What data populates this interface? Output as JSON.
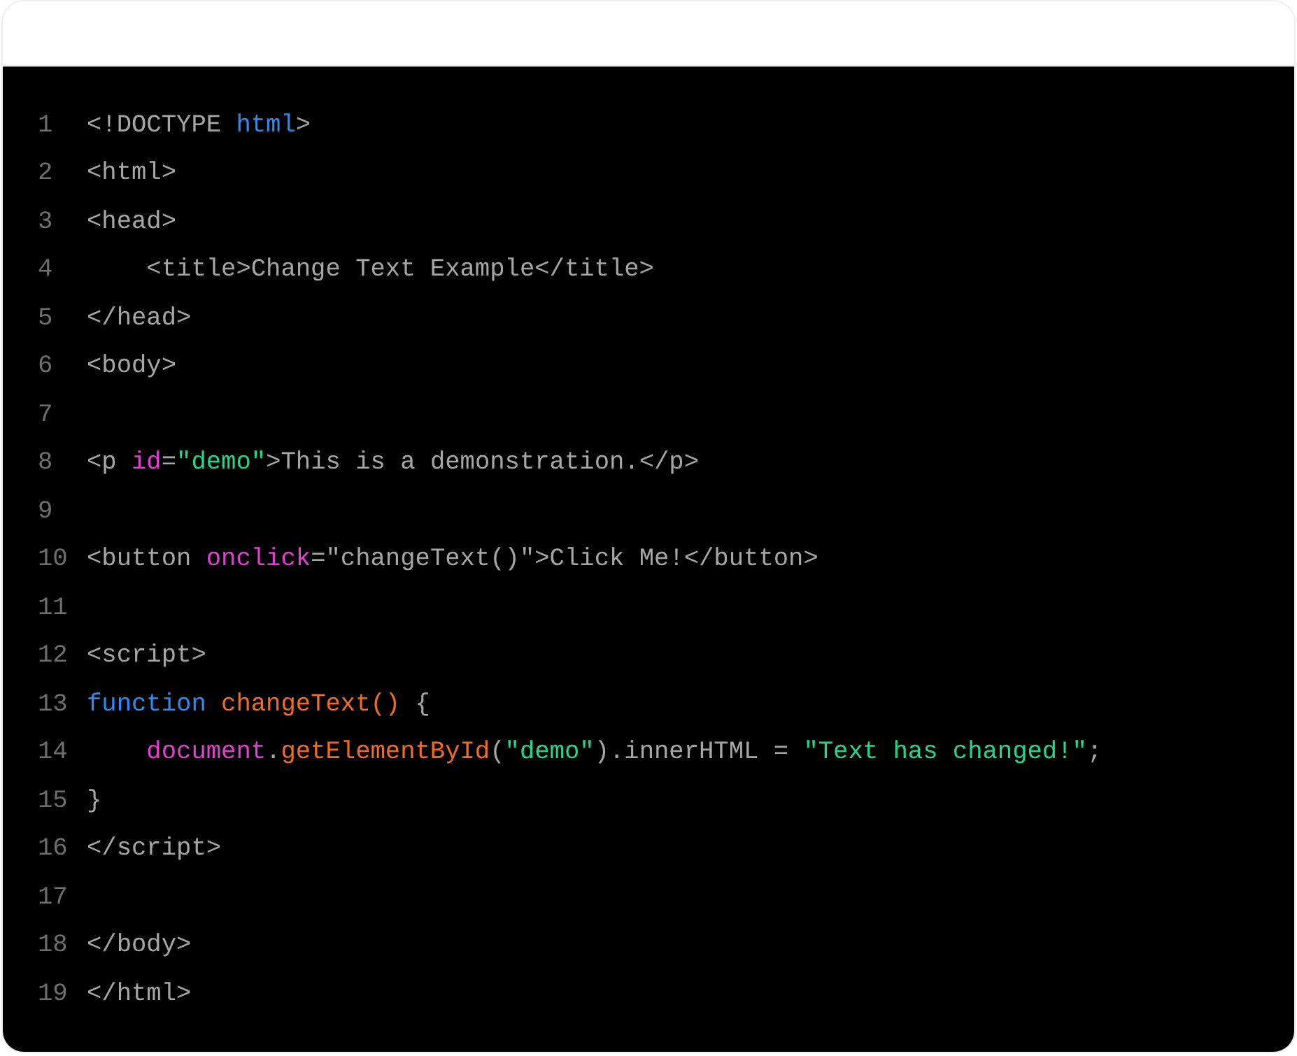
{
  "code_lines": [
    {
      "number": "1",
      "tokens": [
        {
          "text": "<!DOCTYPE ",
          "kind": "plain"
        },
        {
          "text": "html",
          "kind": "keyword"
        },
        {
          "text": ">",
          "kind": "plain"
        }
      ]
    },
    {
      "number": "2",
      "tokens": [
        {
          "text": "<html>",
          "kind": "plain"
        }
      ]
    },
    {
      "number": "3",
      "tokens": [
        {
          "text": "<head>",
          "kind": "plain"
        }
      ]
    },
    {
      "number": "4",
      "tokens": [
        {
          "text": "    <title>Change Text Example</title>",
          "kind": "plain"
        }
      ]
    },
    {
      "number": "5",
      "tokens": [
        {
          "text": "</head>",
          "kind": "plain"
        }
      ]
    },
    {
      "number": "6",
      "tokens": [
        {
          "text": "<body>",
          "kind": "plain"
        }
      ]
    },
    {
      "number": "7"
    },
    {
      "number": "8",
      "tokens": [
        {
          "text": "<p ",
          "kind": "plain"
        },
        {
          "text": "id",
          "kind": "attribute"
        },
        {
          "text": "=",
          "kind": "plain"
        },
        {
          "text": "\"demo\"",
          "kind": "string"
        },
        {
          "text": ">This is a demonstration.</p>",
          "kind": "plain"
        }
      ]
    },
    {
      "number": "9"
    },
    {
      "number": "10",
      "tokens": [
        {
          "text": "<button ",
          "kind": "plain"
        },
        {
          "text": "onclick",
          "kind": "attribute"
        },
        {
          "text": "=\"changeText()\">Click Me!</button>",
          "kind": "plain"
        }
      ]
    },
    {
      "number": "11"
    },
    {
      "number": "12",
      "tokens": [
        {
          "text": "<script>",
          "kind": "plain"
        }
      ]
    },
    {
      "number": "13",
      "tokens": [
        {
          "text": "function ",
          "kind": "keyword"
        },
        {
          "text": "changeText()",
          "kind": "function"
        },
        {
          "text": " {",
          "kind": "plain"
        }
      ]
    },
    {
      "number": "14",
      "tokens": [
        {
          "text": "    document",
          "kind": "attribute"
        },
        {
          "text": ".",
          "kind": "plain"
        },
        {
          "text": "getElementById",
          "kind": "function"
        },
        {
          "text": "(",
          "kind": "plain"
        },
        {
          "text": "\"demo\"",
          "kind": "string"
        },
        {
          "text": ").innerHTML = ",
          "kind": "plain"
        },
        {
          "text": "\"Text has changed!\"",
          "kind": "string"
        },
        {
          "text": ";",
          "kind": "plain"
        }
      ]
    },
    {
      "number": "15",
      "tokens": [
        {
          "text": "}",
          "kind": "plain"
        }
      ]
    },
    {
      "number": "16",
      "tokens": [
        {
          "text": "</script>",
          "kind": "plain"
        }
      ]
    },
    {
      "number": "17"
    },
    {
      "number": "18",
      "tokens": [
        {
          "text": "</body>",
          "kind": "plain"
        }
      ]
    },
    {
      "number": "19",
      "tokens": [
        {
          "text": "</html>",
          "kind": "plain"
        }
      ]
    }
  ]
}
